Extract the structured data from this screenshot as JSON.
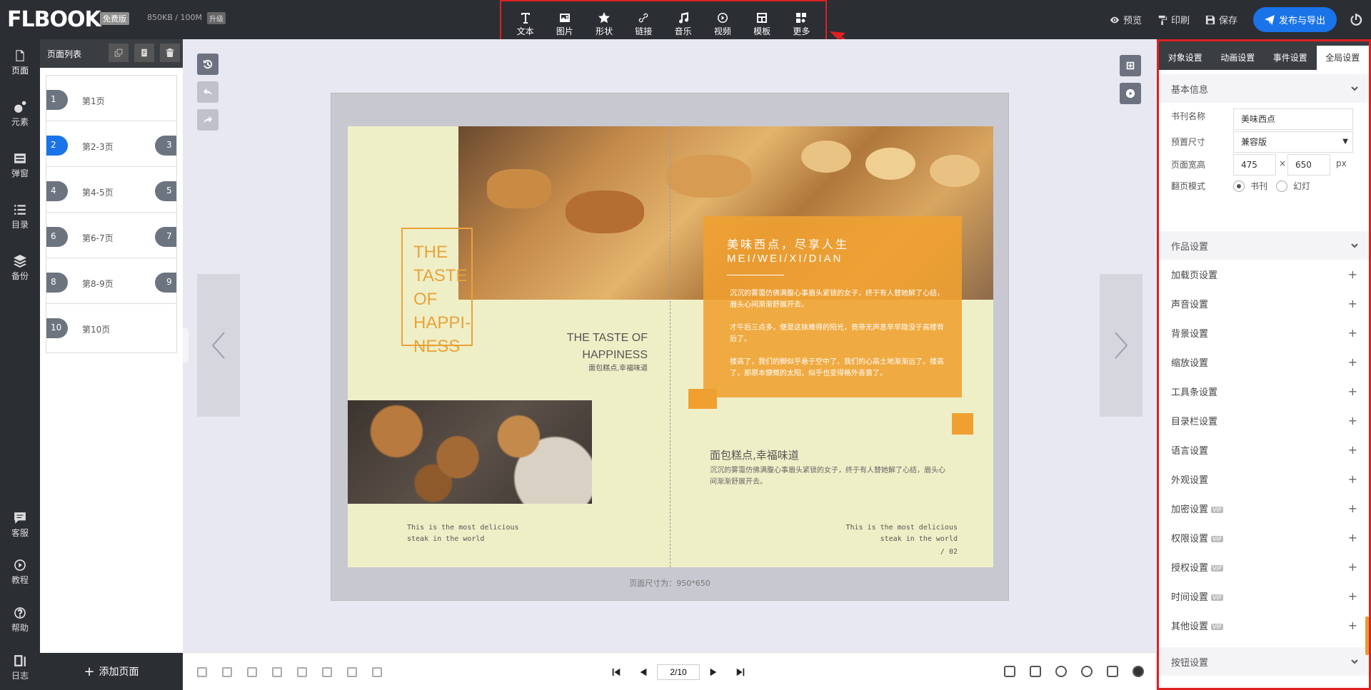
{
  "app": {
    "logo": "FLBOOK",
    "logo_reg": "®",
    "free_badge": "免费版",
    "quota": "850KB / 100M",
    "upgrade": "升级"
  },
  "toolbar": [
    {
      "label": "文本",
      "icon": "text-icon"
    },
    {
      "label": "图片",
      "icon": "image-icon"
    },
    {
      "label": "形状",
      "icon": "star-icon"
    },
    {
      "label": "链接",
      "icon": "link-icon"
    },
    {
      "label": "音乐",
      "icon": "music-icon"
    },
    {
      "label": "视频",
      "icon": "video-icon"
    },
    {
      "label": "模板",
      "icon": "template-icon"
    },
    {
      "label": "更多",
      "icon": "more-icon"
    }
  ],
  "top_actions": {
    "preview": "预览",
    "print": "印刷",
    "save": "保存",
    "publish": "发布与导出"
  },
  "left_nav": {
    "page": "页面",
    "element": "元素",
    "popup": "弹窗",
    "toc": "目录",
    "backup": "备份",
    "service": "客服",
    "tutorial": "教程",
    "help": "帮助",
    "log": "日志"
  },
  "page_panel": {
    "title": "页面列表",
    "add_page": "添加页面",
    "pages": [
      {
        "left": "1",
        "label": "第1页",
        "right": ""
      },
      {
        "left": "2",
        "label": "第2-3页",
        "right": "3"
      },
      {
        "left": "4",
        "label": "第4-5页",
        "right": "5"
      },
      {
        "left": "6",
        "label": "第6-7页",
        "right": "7"
      },
      {
        "left": "8",
        "label": "第8-9页",
        "right": "9"
      },
      {
        "left": "10",
        "label": "第10页",
        "right": ""
      }
    ]
  },
  "book": {
    "left_title_lines": [
      "THE",
      "TASTE",
      "OF",
      "HAPPI-",
      "NESS"
    ],
    "left_sub_en_1": "THE TASTE OF",
    "left_sub_en_2": "HAPPINESS",
    "left_sub_cn": "面包糕点,幸福味道",
    "left_caption_1": "This is the most delicious",
    "left_caption_2": "steak in the world",
    "right_title_cn": "美味西点，尽享人生",
    "right_title_en": "MEI/WEI/XI/DIAN",
    "right_p1": "沉沉的雾霭仿佛满腹心事眉头紧锁的女子，终于有人替她解了心结，眉头心间渐渐舒展开去。",
    "right_p2": "才午后三点多，便是这抹难得的阳光，竟带无声息早早隐没于高楼背后了。",
    "right_p3": "楼高了，我们的脚似乎悬于空中了。我们的心高土地渐渐远了。楼高了，那原本慷慨的太阳，似乎也变得格外吝啬了。",
    "right_sub_title": "面包糕点,幸福味道",
    "right_sub_body": "沉沉的雾霭仿佛满腹心事眉头紧锁的女子，终于有人替她解了心结，眉头心间渐渐舒展开去。",
    "right_caption_1": "This is the most delicious",
    "right_caption_2": "steak in the world",
    "page_no": "/ 02",
    "size_note": "页面尺寸为：950*650"
  },
  "pager": {
    "value": "2/10"
  },
  "right_panel": {
    "tabs": [
      "对象设置",
      "动画设置",
      "事件设置",
      "全局设置"
    ],
    "basic_info": "基本信息",
    "name_label": "书刊名称",
    "name_value": "美味西点",
    "size_label": "预置尺寸",
    "size_value": "兼容版",
    "wh_label": "页面宽高",
    "width": "475",
    "height": "650",
    "times": "×",
    "unit": "px",
    "flip_label": "翻页模式",
    "flip_book": "书刊",
    "flip_slide": "幻灯",
    "work_settings": "作品设置",
    "items": [
      {
        "label": "加载页设置",
        "vip": ""
      },
      {
        "label": "声音设置",
        "vip": ""
      },
      {
        "label": "背景设置",
        "vip": ""
      },
      {
        "label": "缩放设置",
        "vip": ""
      },
      {
        "label": "工具条设置",
        "vip": ""
      },
      {
        "label": "目录栏设置",
        "vip": ""
      },
      {
        "label": "语言设置",
        "vip": ""
      },
      {
        "label": "外观设置",
        "vip": ""
      },
      {
        "label": "加密设置",
        "vip": "VIP"
      },
      {
        "label": "权限设置",
        "vip": "VIP"
      },
      {
        "label": "授权设置",
        "vip": "VIP"
      },
      {
        "label": "时间设置",
        "vip": "VIP"
      },
      {
        "label": "其他设置",
        "vip": "VIP"
      }
    ],
    "button_settings": "按钮设置",
    "plus": "+"
  },
  "colors": {
    "accent": "#1a73e8",
    "dark": "#2b2e33",
    "highlight": "#e02020",
    "orange": "#f0a030",
    "cream": "#efefc7"
  }
}
